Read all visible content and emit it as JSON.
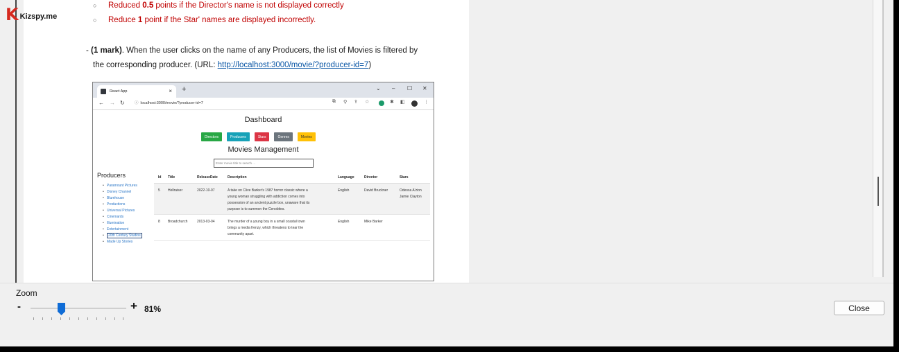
{
  "logo": {
    "letter": "K",
    "text": "Kizspy.me"
  },
  "document": {
    "bullets": [
      {
        "pre": "Reduced ",
        "bold": "0.5",
        "post": " points if the Director's name is not displayed correctly"
      },
      {
        "pre": "Reduce ",
        "bold": "1",
        "post": " point if the Star' names are displayed incorrectly."
      }
    ],
    "para_line1_prefix": "- ",
    "para_line1_bold": "(1 mark)",
    "para_line1_rest": ". When the user clicks on the name of any Producers, the list of Movies is filtered by",
    "para_line2_pre": "the corresponding producer. (URL: ",
    "para_line2_link": "http://localhost:3000/movie/?producer-id=7",
    "para_line2_post": ")"
  },
  "browser": {
    "tab_title": "React App",
    "tab_close": "×",
    "new_tab": "+",
    "url": "localhost:3000/movie/?producer-id=7",
    "window_controls": [
      "⌄",
      "–",
      "☐",
      "✕"
    ]
  },
  "app": {
    "dashboard_title": "Dashboard",
    "nav_buttons": [
      {
        "label": "Directors",
        "color": "#28a745"
      },
      {
        "label": "Producers",
        "color": "#17a2b8"
      },
      {
        "label": "Stars",
        "color": "#dc3545"
      },
      {
        "label": "Genres",
        "color": "#6c757d"
      },
      {
        "label": "Movies",
        "color": "#ffc107"
      }
    ],
    "management_title": "Movies Management",
    "search_placeholder": "Enter movie title to search ...",
    "sidebar_title": "Producers",
    "producers": [
      "Paramount Pictures",
      "Disney Channel",
      "Blumhouse",
      "Productions",
      "Universal Pictures",
      "Cinemards",
      "Illumination",
      "Entertainment",
      "20th Century Studios",
      "Made Up Stories"
    ],
    "table": {
      "headers": [
        "Id",
        "Title",
        "ReleaseDate",
        "Description",
        "Language",
        "Director",
        "Stars"
      ],
      "rows": [
        {
          "id": "5",
          "title": "Hellraiser",
          "date": "2022-10-07",
          "desc": [
            "A take on Clive Barker's 1987 horror classic where a",
            "young woman struggling with addiction comes into",
            "possession of an ancient puzzle box, unaware that its",
            "purpose is to summon the Cenobites."
          ],
          "language": "English",
          "director": "David Bruckner",
          "stars": [
            "Odessa A'zion",
            "Jamie Clayton"
          ]
        },
        {
          "id": "8",
          "title": "Broadchurch",
          "date": "2013-03-04",
          "desc": [
            "The murder of a young boy in a small coastal town",
            "brings a media frenzy, which threatens to tear the",
            "community apart."
          ],
          "language": "English",
          "director": "Mike Barker",
          "stars": []
        }
      ]
    }
  },
  "zoom": {
    "label": "Zoom",
    "minus": "-",
    "plus": "+",
    "value": "81%",
    "level_percent": 81
  },
  "close_label": "Close",
  "colors": {
    "accent": "#0f6cd6",
    "bullet_red": "#c00000",
    "link": "#0b57a6"
  }
}
